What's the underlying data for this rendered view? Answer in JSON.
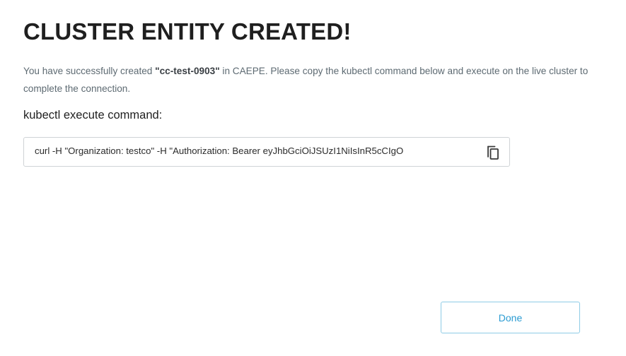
{
  "dialog": {
    "title": "CLUSTER ENTITY CREATED!",
    "message_prefix": "You have successfully created ",
    "cluster_name": "\"cc-test-0903\"",
    "message_suffix": " in CAEPE. Please copy the kubectl command below and execute on the live cluster to complete the connection.",
    "command_label": "kubectl execute command:",
    "command_text": "curl -H \"Organization: testco\" -H \"Authorization: Bearer eyJhbGciOiJSUzI1NiIsInR5cCIgO",
    "copy_icon": "copy-icon",
    "done_label": "Done"
  },
  "colors": {
    "title": "#1f1f1f",
    "message": "#5d6a72",
    "accent": "#2a9bd2",
    "button_border": "#8ecbe6",
    "field_border": "#cfd3d6"
  }
}
